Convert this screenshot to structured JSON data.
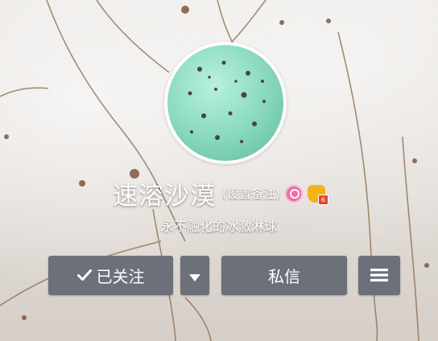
{
  "profile": {
    "nickname": "速溶沙漠",
    "remark_link": "(设置备注)",
    "bio": "永不融化的冰激淋球"
  },
  "badges": [
    {
      "icon": "pink-circle-badge-icon",
      "color": "#f06aa8"
    },
    {
      "icon": "crown-level-badge-icon",
      "color": "#f6b21b",
      "level": "6"
    }
  ],
  "actions": {
    "follow_label": "已关注",
    "message_label": "私信"
  },
  "colors": {
    "button_bg": "#6c7079",
    "avatar_mint": "#8fdcc3"
  }
}
